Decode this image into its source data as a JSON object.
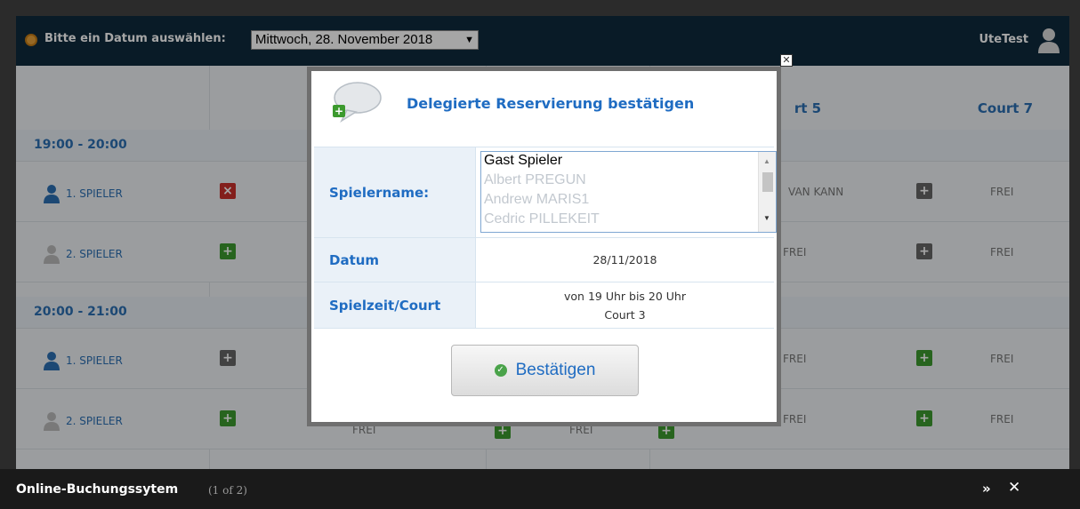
{
  "header": {
    "date_label": "Bitte ein Datum auswählen:",
    "date_value": "Mittwoch, 28. November 2018",
    "user": "UteTest"
  },
  "courts": {
    "col_a": "rt 5",
    "col_b": "Court 7"
  },
  "schedule": [
    {
      "time": "19:00 - 20:00",
      "players": [
        {
          "label": "1. SPIELER",
          "c5": "VAN KANN",
          "c7": "FREI"
        },
        {
          "label": "2. SPIELER",
          "c5": "FREI",
          "c7": "FREI"
        }
      ]
    },
    {
      "time": "20:00 - 21:00",
      "players": [
        {
          "label": "1. SPIELER",
          "c5": "FREI",
          "c7": "FREI"
        },
        {
          "label": "2. SPIELER",
          "c5": "FREI",
          "c7": "FREI"
        }
      ]
    }
  ],
  "partial_labels": {
    "hidden_frei_a": "FREI",
    "hidden_frei_b": "FREI"
  },
  "modal": {
    "title": "Delegierte Reservierung bestätigen",
    "player_label": "Spielername:",
    "players": [
      "Gast Spieler",
      "Albert PREGUN",
      "Andrew MARIS1",
      "Cedric PILLEKEIT"
    ],
    "date_label": "Datum",
    "date_value": "28/11/2018",
    "slot_label": "Spielzeit/Court",
    "slot_time": "von 19 Uhr bis 20 Uhr",
    "slot_court": "Court 3",
    "confirm_label": "Bestätigen"
  },
  "footer": {
    "title": "Online-Buchungssytem",
    "count": "(1 of 2)",
    "next": "»",
    "close": "✕"
  }
}
